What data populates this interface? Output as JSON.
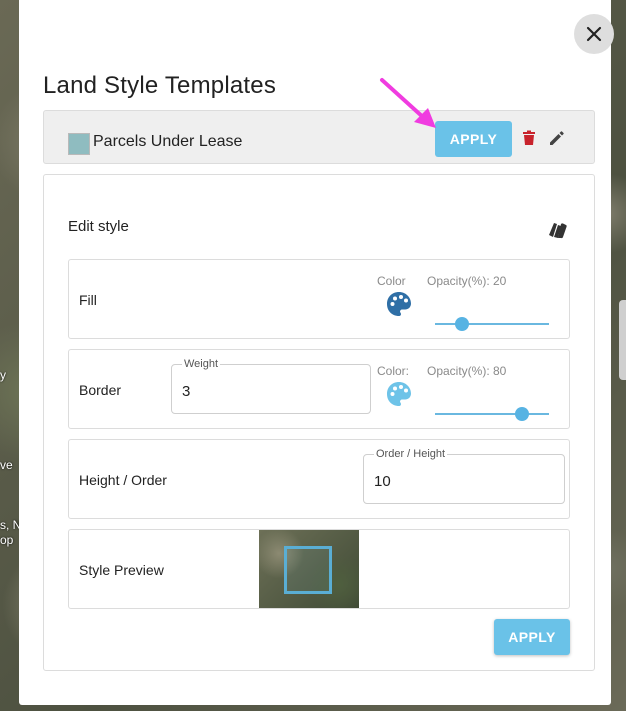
{
  "map": {
    "edge_labels": [
      "y",
      "ve",
      "s, Ne",
      "op"
    ]
  },
  "modal": {
    "title": "Land Style Templates",
    "close_icon": "close-icon"
  },
  "template": {
    "name": "Parcels Under Lease",
    "swatch_color": "#8fbcc0",
    "apply_label": "APPLY",
    "delete_icon": "trash-icon",
    "edit_icon": "pencil-icon"
  },
  "editor": {
    "heading": "Edit style",
    "reset_icon": "swatch-book-icon",
    "fill": {
      "label": "Fill",
      "color_label": "Color",
      "color": "#2f6fa6",
      "opacity_label": "Opacity(%): 20",
      "opacity": 20
    },
    "border": {
      "label": "Border",
      "weight_label": "Weight",
      "weight_value": "3",
      "color_label": "Color:",
      "color": "#6ec3e8",
      "opacity_label": "Opacity(%): 80",
      "opacity": 80
    },
    "height_order": {
      "label": "Height / Order",
      "field_label": "Order / Height",
      "field_value": "10"
    },
    "preview": {
      "label": "Style Preview"
    },
    "apply_label": "APPLY"
  },
  "colors": {
    "accent": "#6ac2e8",
    "delete": "#c8232c",
    "annotation_arrow": "#f03ce0"
  }
}
